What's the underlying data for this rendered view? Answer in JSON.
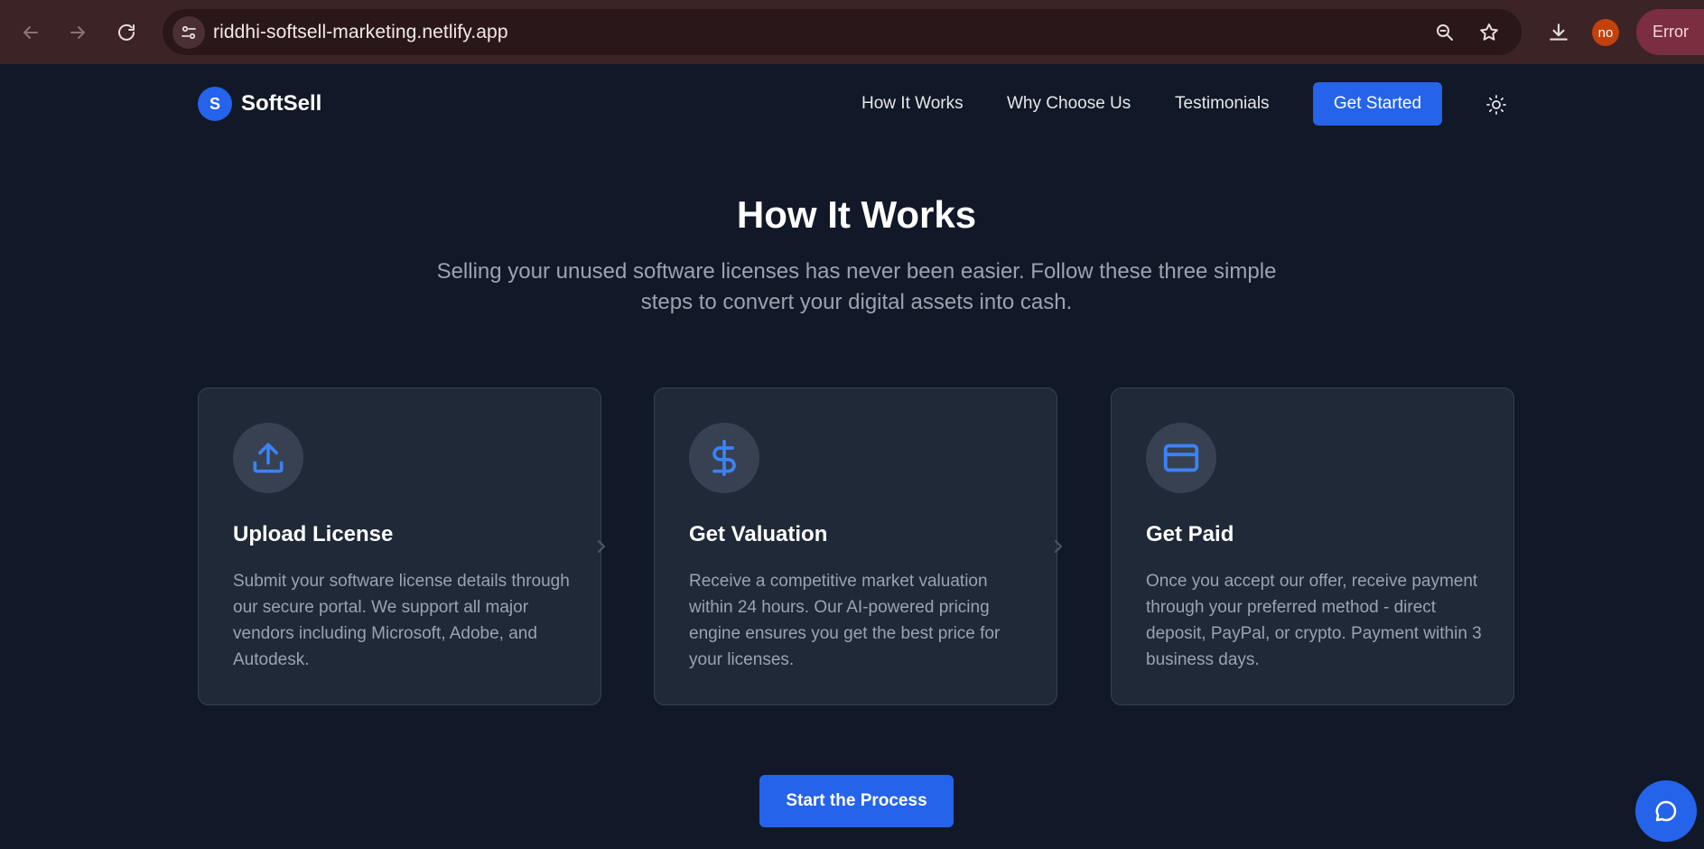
{
  "browser": {
    "url": "riddhi-softsell-marketing.netlify.app",
    "profile_initials": "no",
    "error_label": "Error",
    "icons": [
      "back-arrow-icon",
      "forward-arrow-icon",
      "reload-icon",
      "site-settings-icon",
      "zoom-icon",
      "star-icon",
      "download-icon"
    ]
  },
  "header": {
    "logo_letter": "S",
    "brand": "SoftSell",
    "nav": [
      "How It Works",
      "Why Choose Us",
      "Testimonials"
    ],
    "cta": "Get Started",
    "theme_icon": "sun-icon"
  },
  "main": {
    "title": "How It Works",
    "subtitle": "Selling your unused software licenses has never been easier. Follow these three simple steps to convert your digital assets into cash.",
    "steps": [
      {
        "icon": "upload-icon",
        "title": "Upload License",
        "description": "Submit your software license details through our secure portal. We support all major vendors including Microsoft, Adobe, and Autodesk."
      },
      {
        "icon": "dollar-icon",
        "title": "Get Valuation",
        "description": "Receive a competitive market valuation within 24 hours. Our AI-powered pricing engine ensures you get the best price for your licenses."
      },
      {
        "icon": "credit-card-icon",
        "title": "Get Paid",
        "description": "Once you accept our offer, receive payment through your preferred method - direct deposit, PayPal, or crypto. Payment within 3 business days."
      }
    ],
    "cta": "Start the Process"
  },
  "chat": {
    "icon": "chat-bubble-icon"
  },
  "colors": {
    "background": "#111827",
    "card": "#1f2937",
    "accent": "#2563eb",
    "muted_text": "#9ca3af"
  }
}
